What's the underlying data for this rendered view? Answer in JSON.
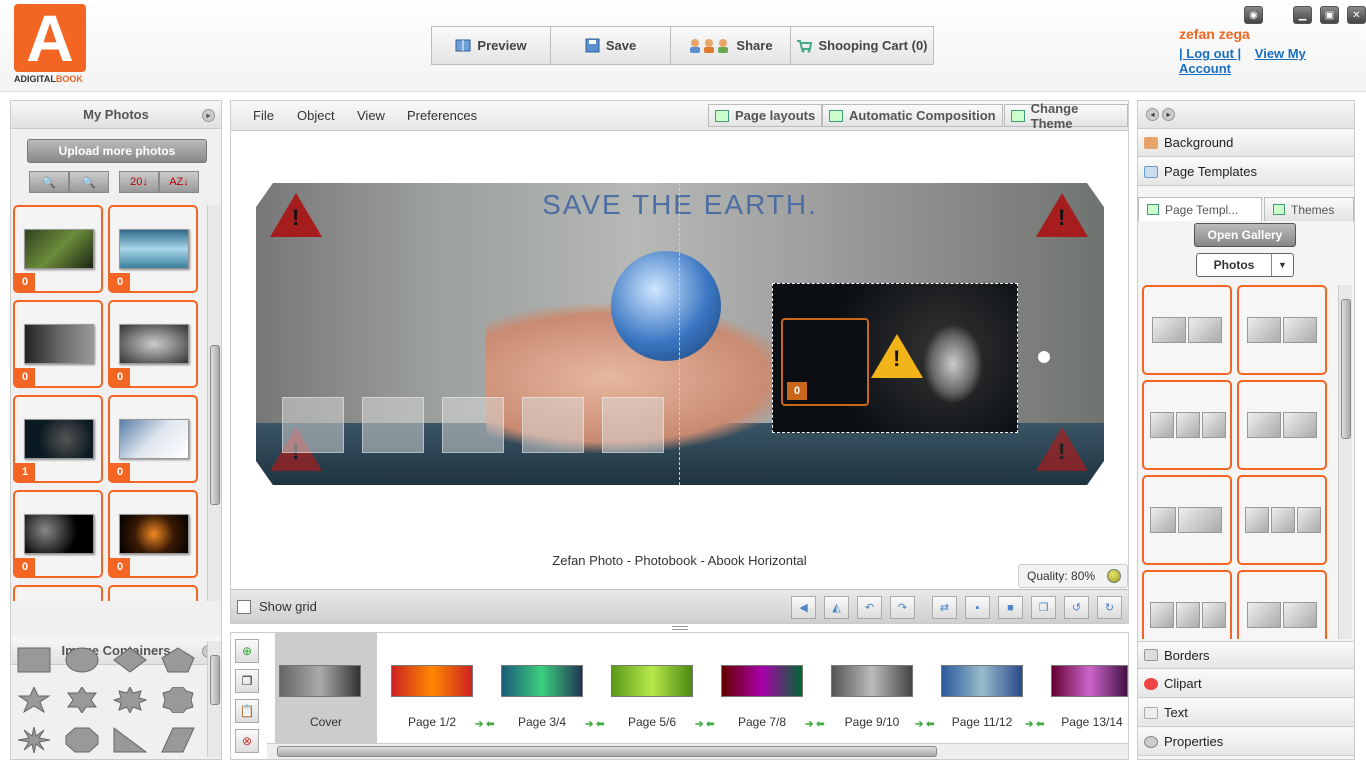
{
  "brand": {
    "logo_letter": "A",
    "logo_text_a": "ADIGITAL",
    "logo_text_b": "BOOK"
  },
  "mainnav": {
    "preview": "Preview",
    "save": "Save",
    "share": "Share",
    "cart": "Shooping Cart (0)"
  },
  "user": {
    "name": "zefan zega",
    "logout": "| Log out |",
    "account": "View My Account"
  },
  "left": {
    "title": "My Photos",
    "upload": "Upload more photos",
    "sort_date": "20",
    "sort_az": "AZ",
    "photos": [
      {
        "count": "0"
      },
      {
        "count": "0"
      },
      {
        "count": "0"
      },
      {
        "count": "0"
      },
      {
        "count": "1"
      },
      {
        "count": "0"
      },
      {
        "count": "0"
      },
      {
        "count": "0"
      }
    ],
    "containers_title": "Image Containers"
  },
  "editor": {
    "menus": [
      "File",
      "Object",
      "View",
      "Preferences"
    ],
    "page_layouts": "Page layouts",
    "auto_comp": "Automatic Composition",
    "change_theme": "Change Theme",
    "canvas_title": "SAVE THE EARTH.",
    "slot_count": "0",
    "book_name": "Zefan Photo - Photobook - Abook Horizontal",
    "quality": "Quality: 80%",
    "show_grid": "Show grid"
  },
  "pages": {
    "cover": "Cover",
    "labels": [
      "Page 1/2",
      "Page 3/4",
      "Page 5/6",
      "Page 7/8",
      "Page 9/10",
      "Page 11/12",
      "Page 13/14"
    ]
  },
  "right": {
    "background": "Background",
    "page_templates": "Page Templates",
    "tab_templates": "Page Templ...",
    "tab_themes": "Themes",
    "open_gallery": "Open Gallery",
    "photos_select": "Photos",
    "borders": "Borders",
    "clipart": "Clipart",
    "text": "Text",
    "properties": "Properties"
  },
  "colors": {
    "accent": "#f26522",
    "link": "#1a6fc0"
  }
}
